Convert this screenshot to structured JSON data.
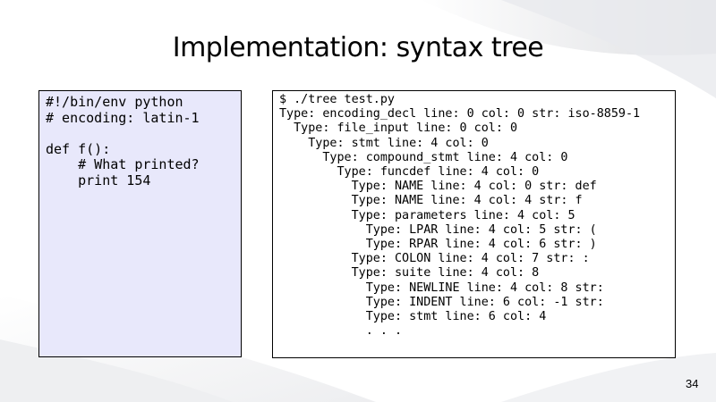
{
  "slide": {
    "title": "Implementation: syntax tree",
    "page_number": "34"
  },
  "source_code": {
    "lines": [
      "#!/bin/env python",
      "# encoding: latin-1",
      "",
      "def f():",
      "    # What printed?",
      "    print 154"
    ]
  },
  "terminal_output": {
    "lines": [
      "$ ./tree test.py",
      "Type: encoding_decl line: 0 col: 0 str: iso-8859-1",
      "  Type: file_input line: 0 col: 0",
      "    Type: stmt line: 4 col: 0",
      "      Type: compound_stmt line: 4 col: 0",
      "        Type: funcdef line: 4 col: 0",
      "          Type: NAME line: 4 col: 0 str: def",
      "          Type: NAME line: 4 col: 4 str: f",
      "          Type: parameters line: 4 col: 5",
      "            Type: LPAR line: 4 col: 5 str: (",
      "            Type: RPAR line: 4 col: 6 str: )",
      "          Type: COLON line: 4 col: 7 str: :",
      "          Type: suite line: 4 col: 8",
      "            Type: NEWLINE line: 4 col: 8 str:",
      "            Type: INDENT line: 6 col: -1 str:",
      "            Type: stmt line: 6 col: 4",
      "            . . ."
    ]
  }
}
